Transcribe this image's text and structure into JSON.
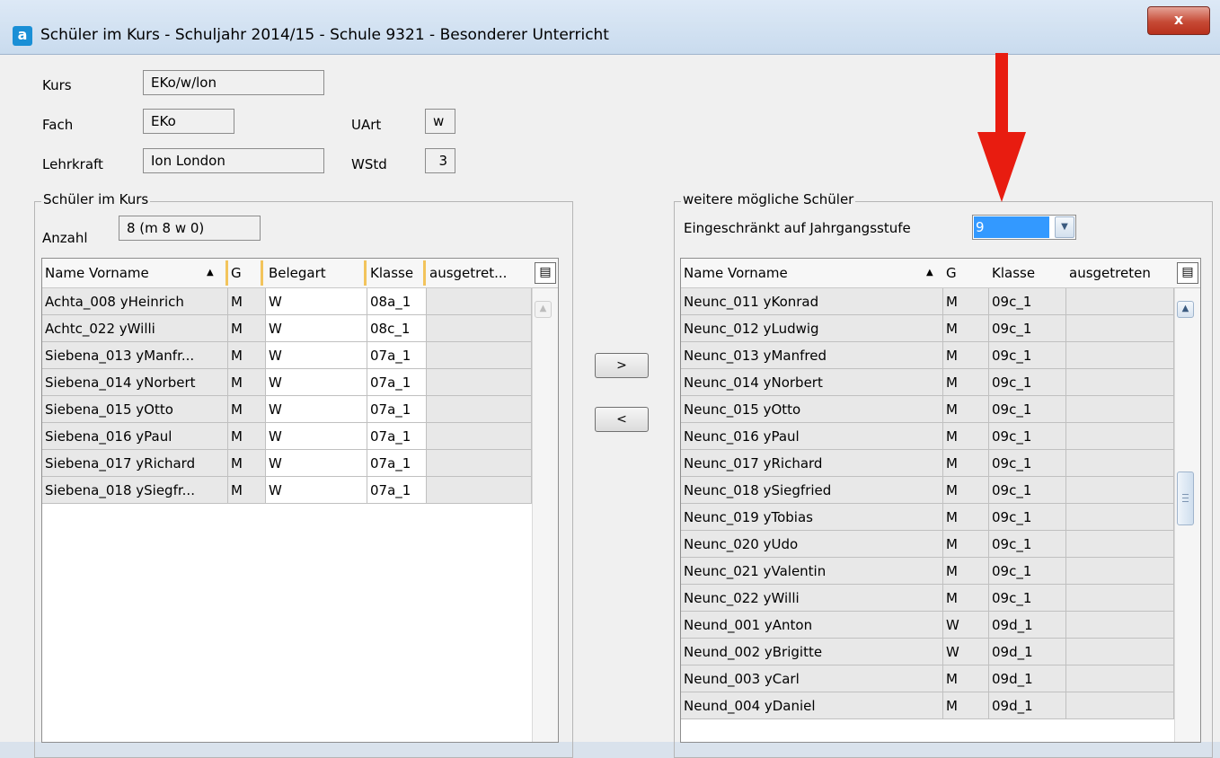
{
  "window": {
    "title": "Schüler im Kurs - Schuljahr 2014/15 - Schule 9321 - Besonderer Unterricht",
    "close_label": "x",
    "app_icon_letter": "a"
  },
  "course": {
    "kurs_label": "Kurs",
    "kurs_value": "EKo/w/lon",
    "fach_label": "Fach",
    "fach_value": "EKo",
    "uart_label": "UArt",
    "uart_value": "w",
    "lehrkraft_label": "Lehrkraft",
    "lehrkraft_value": "Ion London",
    "wstd_label": "WStd",
    "wstd_value": "3"
  },
  "enrolled": {
    "group_title": "Schüler im Kurs",
    "count_label": "Anzahl",
    "count_value": "8 (m 8 w 0)",
    "columns": [
      "Name Vorname",
      "G",
      "Belegart",
      "Klasse",
      "ausgetret..."
    ],
    "column_menu_icon": "column-chooser-icon",
    "rows": [
      [
        "Achta_008 yHeinrich",
        "M",
        "W",
        "08a_1",
        ""
      ],
      [
        "Achtc_022 yWilli",
        "M",
        "W",
        "08c_1",
        ""
      ],
      [
        "Siebena_013 yManfr...",
        "M",
        "W",
        "07a_1",
        ""
      ],
      [
        "Siebena_014 yNorbert",
        "M",
        "W",
        "07a_1",
        ""
      ],
      [
        "Siebena_015 yOtto",
        "M",
        "W",
        "07a_1",
        ""
      ],
      [
        "Siebena_016 yPaul",
        "M",
        "W",
        "07a_1",
        ""
      ],
      [
        "Siebena_017 yRichard",
        "M",
        "W",
        "07a_1",
        ""
      ],
      [
        "Siebena_018 ySiegfr...",
        "M",
        "W",
        "07a_1",
        ""
      ]
    ]
  },
  "move": {
    "add_label": ">",
    "remove_label": "<"
  },
  "available": {
    "group_title": "weitere mögliche Schüler",
    "filter_label": "Eingeschränkt auf Jahrgangsstufe",
    "filter_value": "9",
    "columns": [
      "Name Vorname",
      "G",
      "Klasse",
      "ausgetreten"
    ],
    "rows": [
      [
        "Neunc_011 yKonrad",
        "M",
        "09c_1",
        ""
      ],
      [
        "Neunc_012 yLudwig",
        "M",
        "09c_1",
        ""
      ],
      [
        "Neunc_013 yManfred",
        "M",
        "09c_1",
        ""
      ],
      [
        "Neunc_014 yNorbert",
        "M",
        "09c_1",
        ""
      ],
      [
        "Neunc_015 yOtto",
        "M",
        "09c_1",
        ""
      ],
      [
        "Neunc_016 yPaul",
        "M",
        "09c_1",
        ""
      ],
      [
        "Neunc_017 yRichard",
        "M",
        "09c_1",
        ""
      ],
      [
        "Neunc_018 ySiegfried",
        "M",
        "09c_1",
        ""
      ],
      [
        "Neunc_019 yTobias",
        "M",
        "09c_1",
        ""
      ],
      [
        "Neunc_020 yUdo",
        "M",
        "09c_1",
        ""
      ],
      [
        "Neunc_021 yValentin",
        "M",
        "09c_1",
        ""
      ],
      [
        "Neunc_022 yWilli",
        "M",
        "09c_1",
        ""
      ],
      [
        "Neund_001 yAnton",
        "W",
        "09d_1",
        ""
      ],
      [
        "Neund_002 yBrigitte",
        "W",
        "09d_1",
        ""
      ],
      [
        "Neund_003 yCarl",
        "M",
        "09d_1",
        ""
      ],
      [
        "Neund_004 yDaniel",
        "M",
        "09d_1",
        ""
      ]
    ]
  },
  "annotation": {
    "arrow_color": "#e81c10"
  },
  "colors": {
    "selection": "#3399ff",
    "header_separator": "#f2c45c",
    "close_button": "#c64a35"
  }
}
